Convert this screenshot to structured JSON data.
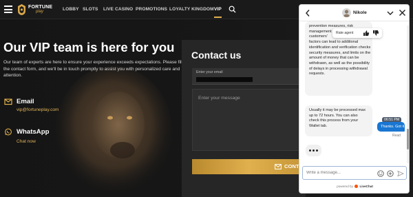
{
  "nav": {
    "logo_text": "FORTUNE",
    "logo_sub": "play",
    "items": [
      {
        "label": "LOBBY"
      },
      {
        "label": "SLOTS"
      },
      {
        "label": "LIVE CASINO"
      },
      {
        "label": "PROMOTIONS"
      },
      {
        "label": "LOYALTY KINGDOM"
      },
      {
        "label": "VIP",
        "active": true
      }
    ]
  },
  "hero": {
    "title": "Our VIP team is here for you",
    "description": "Our team of experts are here to ensure your experience exceeds expectations. Please fill out the contact form, and we'll be in touch promptly to assist you with personalized care and attention.",
    "email": {
      "label": "Email",
      "value": "vip@fortuneplay.com"
    },
    "whatsapp": {
      "label": "WhatsApp",
      "link": "Chat now"
    }
  },
  "form": {
    "title": "Contact us",
    "email_label": "Enter your email",
    "message_placeholder": "Enter your message",
    "button_label": "CONTACT"
  },
  "chat": {
    "agent_name": "Nikole",
    "message_1_lines": [
      "prevention measures, risk",
      "management",
      "customers'",
      "factors can lead to additional",
      "identification and verification checks",
      "security measures, and limits on the",
      "amount of money that can be",
      "withdrawn, as well as the possibility",
      "of delays in processing withdrawal",
      "requests."
    ],
    "rate_label": "Rate agent",
    "message_2": "Usually it may be processed max up to 72 hours. You can also check this process from your Wallet tab.",
    "user_time": "06:51 PM",
    "user_message": "Thanks. Got it :)",
    "read_status": "Read",
    "composer_placeholder": "Write a message...",
    "powered_by": "powered by",
    "powered_brand": "LiveChat"
  },
  "colors": {
    "gold": "#e0b04e",
    "chat_blue": "#1976d2",
    "dark_bg": "#151515"
  }
}
